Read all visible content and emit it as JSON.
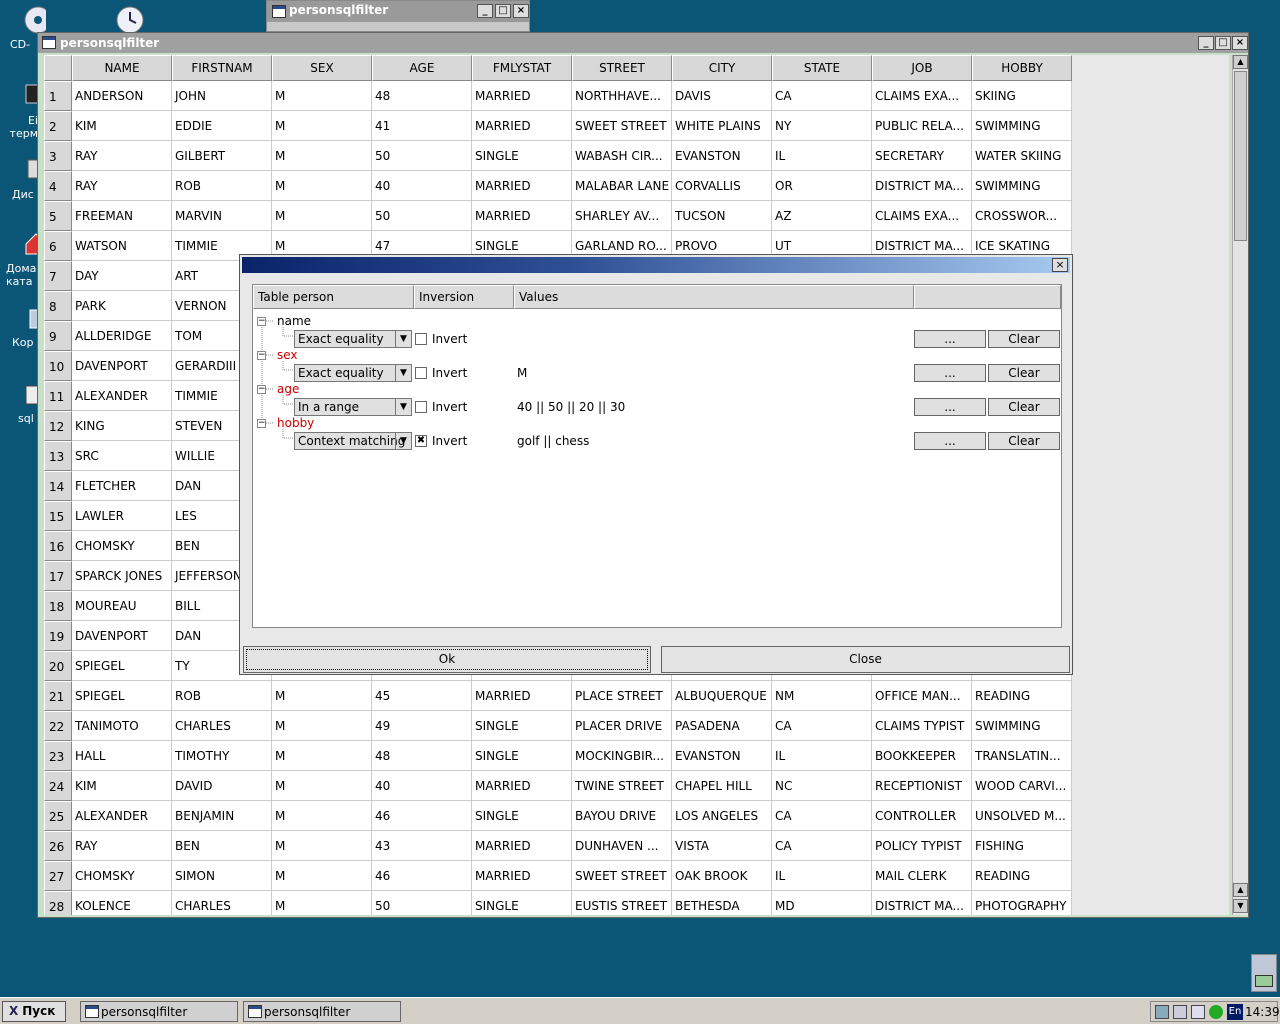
{
  "desktop": {
    "icons": [
      {
        "label": "CD-"
      },
      {
        "label": ""
      },
      {
        "label": "Ei терм"
      },
      {
        "label": "Дис"
      },
      {
        "label": "Дома ката"
      },
      {
        "label": "Кор"
      },
      {
        "label": "sql"
      }
    ]
  },
  "bg_window": {
    "title": "personsqlfilter"
  },
  "main_window": {
    "title": "personsqlfilter",
    "buttons": {
      "min": "_",
      "max": "□",
      "close": "×"
    }
  },
  "table": {
    "columns": [
      "NAME",
      "FIRSTNAM",
      "SEX",
      "AGE",
      "FMLYSTAT",
      "STREET",
      "CITY",
      "STATE",
      "JOB",
      "HOBBY"
    ],
    "rows": [
      [
        "1",
        "ANDERSON",
        "JOHN",
        "M",
        "48",
        "MARRIED",
        "NORTHHAVE...",
        "DAVIS",
        "CA",
        "CLAIMS EXA...",
        "SKIING"
      ],
      [
        "2",
        "KIM",
        "EDDIE",
        "M",
        "41",
        "MARRIED",
        "SWEET STREET",
        "WHITE PLAINS",
        "NY",
        "PUBLIC RELA...",
        "SWIMMING"
      ],
      [
        "3",
        "RAY",
        "GILBERT",
        "M",
        "50",
        "SINGLE",
        "WABASH CIR...",
        "EVANSTON",
        "IL",
        "SECRETARY",
        "WATER SKIING"
      ],
      [
        "4",
        "RAY",
        "ROB",
        "M",
        "40",
        "MARRIED",
        "MALABAR LANE",
        "CORVALLIS",
        "OR",
        "DISTRICT MA...",
        "SWIMMING"
      ],
      [
        "5",
        "FREEMAN",
        "MARVIN",
        "M",
        "50",
        "MARRIED",
        "SHARLEY AV...",
        "TUCSON",
        "AZ",
        "CLAIMS EXA...",
        "CROSSWOR..."
      ],
      [
        "6",
        "WATSON",
        "TIMMIE",
        "M",
        "47",
        "SINGLE",
        "GARLAND RO...",
        "PROVO",
        "UT",
        "DISTRICT MA...",
        "ICE SKATING"
      ],
      [
        "7",
        "DAY",
        "ART",
        "",
        "",
        "",
        "",
        "",
        "",
        "",
        ""
      ],
      [
        "8",
        "PARK",
        "VERNON",
        "",
        "",
        "",
        "",
        "",
        "",
        "",
        ""
      ],
      [
        "9",
        "ALLDERIDGE",
        "TOM",
        "",
        "",
        "",
        "",
        "",
        "",
        "",
        ""
      ],
      [
        "10",
        "DAVENPORT",
        "GERARDIII",
        "",
        "",
        "",
        "",
        "",
        "",
        "",
        ""
      ],
      [
        "11",
        "ALEXANDER",
        "TIMMIE",
        "",
        "",
        "",
        "",
        "",
        "",
        "",
        ""
      ],
      [
        "12",
        "KING",
        "STEVEN",
        "",
        "",
        "",
        "",
        "",
        "",
        "",
        ""
      ],
      [
        "13",
        "SRC",
        "WILLIE",
        "",
        "",
        "",
        "",
        "",
        "",
        "",
        ""
      ],
      [
        "14",
        "FLETCHER",
        "DAN",
        "",
        "",
        "",
        "",
        "",
        "",
        "",
        ""
      ],
      [
        "15",
        "LAWLER",
        "LES",
        "",
        "",
        "",
        "",
        "",
        "",
        "",
        ""
      ],
      [
        "16",
        "CHOMSKY",
        "BEN",
        "",
        "",
        "",
        "",
        "",
        "",
        "",
        ""
      ],
      [
        "17",
        "SPARCK JONES",
        "JEFFERSON",
        "",
        "",
        "",
        "",
        "",
        "",
        "",
        ""
      ],
      [
        "18",
        "MOUREAU",
        "BILL",
        "",
        "",
        "",
        "",
        "",
        "",
        "",
        ""
      ],
      [
        "19",
        "DAVENPORT",
        "DAN",
        "",
        "",
        "",
        "",
        "",
        "",
        "",
        ""
      ],
      [
        "20",
        "SPIEGEL",
        "TY",
        "",
        "",
        "",
        "",
        "",
        "",
        "",
        ""
      ],
      [
        "21",
        "SPIEGEL",
        "ROB",
        "M",
        "45",
        "MARRIED",
        "PLACE STREET",
        "ALBUQUERQUE",
        "NM",
        "OFFICE MAN...",
        "READING"
      ],
      [
        "22",
        "TANIMOTO",
        "CHARLES",
        "M",
        "49",
        "SINGLE",
        "PLACER DRIVE",
        "PASADENA",
        "CA",
        "CLAIMS TYPIST",
        "SWIMMING"
      ],
      [
        "23",
        "HALL",
        "TIMOTHY",
        "M",
        "48",
        "SINGLE",
        "MOCKINGBIR...",
        "EVANSTON",
        "IL",
        "BOOKKEEPER",
        "TRANSLATIN..."
      ],
      [
        "24",
        "KIM",
        "DAVID",
        "M",
        "40",
        "MARRIED",
        "TWINE STREET",
        "CHAPEL HILL",
        "NC",
        "RECEPTIONIST",
        "WOOD CARVI..."
      ],
      [
        "25",
        "ALEXANDER",
        "BENJAMIN",
        "M",
        "46",
        "SINGLE",
        "BAYOU DRIVE",
        "LOS ANGELES",
        "CA",
        "CONTROLLER",
        "UNSOLVED M..."
      ],
      [
        "26",
        "RAY",
        "BEN",
        "M",
        "43",
        "MARRIED",
        "DUNHAVEN ...",
        "VISTA",
        "CA",
        "POLICY TYPIST",
        "FISHING"
      ],
      [
        "27",
        "CHOMSKY",
        "SIMON",
        "M",
        "46",
        "MARRIED",
        "SWEET STREET",
        "OAK BROOK",
        "IL",
        "MAIL CLERK",
        "READING"
      ],
      [
        "28",
        "KOLENCE",
        "CHARLES",
        "M",
        "50",
        "SINGLE",
        "EUSTIS STREET",
        "BETHESDA",
        "MD",
        "DISTRICT MA...",
        "PHOTOGRAPHY"
      ]
    ]
  },
  "dialog": {
    "close": "×",
    "headers": [
      "Table person",
      "Inversion",
      "Values",
      ""
    ],
    "filters": [
      {
        "field": "name",
        "mode": "Exact equality",
        "invert_label": "Invert",
        "invert": "",
        "values": "",
        "highlight": false
      },
      {
        "field": "sex",
        "mode": "Exact equality",
        "invert_label": "Invert",
        "invert": "",
        "values": "M",
        "highlight": true
      },
      {
        "field": "age",
        "mode": "In a range",
        "invert_label": "Invert",
        "invert": "",
        "values": "40 || 50 || 20 || 30",
        "highlight": true
      },
      {
        "field": "hobby",
        "mode": "Context matching",
        "invert_label": "Invert",
        "invert": "✖",
        "values": "golf || chess",
        "highlight": true
      }
    ],
    "browse_label": "...",
    "clear_label": "Clear",
    "ok_label": "Ok",
    "close_label": "Close"
  },
  "taskbar": {
    "start": "Пуск",
    "tasks": [
      "personsqlfilter",
      "personsqlfilter"
    ],
    "lang": "En",
    "time": "14:39"
  },
  "colors": {
    "desktop": "#0b5677",
    "highlight_field": "#cc0000",
    "title_gradient_start": "#0a246a"
  }
}
